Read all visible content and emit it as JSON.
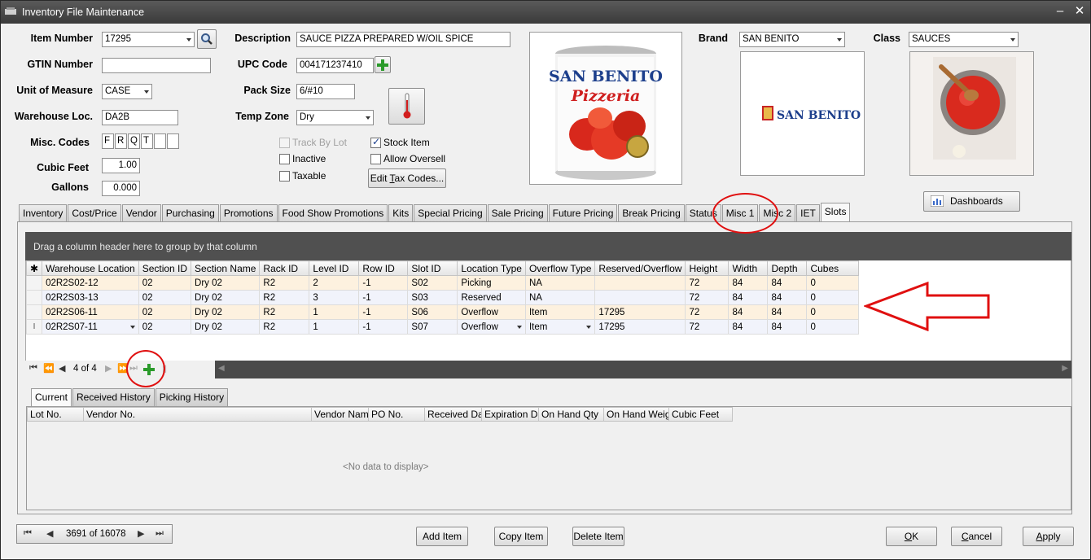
{
  "window": {
    "title": "Inventory File Maintenance",
    "min_glyph": "‒",
    "close_glyph": "✕"
  },
  "form": {
    "item_number_label": "Item Number",
    "item_number": "17295",
    "gtin_label": "GTIN Number",
    "gtin": "",
    "uom_label": "Unit of Measure",
    "uom": "CASE",
    "warehouse_label": "Warehouse Loc.",
    "warehouse": "DA2B",
    "misc_label": "Misc. Codes",
    "misc_codes": [
      "F",
      "R",
      "Q",
      "T",
      "",
      ""
    ],
    "cubic_label": "Cubic Feet",
    "cubic": "1.00",
    "gallons_label": "Gallons",
    "gallons": "0.000",
    "description_label": "Description",
    "description": "SAUCE PIZZA PREPARED W/OIL SPICE",
    "upc_label": "UPC Code",
    "upc": "004171237410",
    "pack_label": "Pack Size",
    "pack": "6/#10",
    "temp_label": "Temp Zone",
    "temp": "Dry",
    "brand_label": "Brand",
    "brand": "SAN BENITO",
    "class_label": "Class",
    "class": "SAUCES",
    "product_brand_text": "SAN BENITO",
    "product_sub_text": "Pizzeria",
    "brand_logo_text": "SAN BENITO"
  },
  "checkboxes": {
    "track_by_lot": {
      "label": "Track By Lot",
      "checked": false,
      "disabled": true
    },
    "inactive": {
      "label": "Inactive",
      "checked": false
    },
    "taxable": {
      "label": "Taxable",
      "checked": false
    },
    "stock_item": {
      "label": "Stock Item",
      "checked": true
    },
    "allow_oversell": {
      "label": "Allow Oversell",
      "checked": false
    }
  },
  "buttons": {
    "edit_tax_pre": "Edit ",
    "edit_tax_acc": "T",
    "edit_tax_post": "ax Codes...",
    "dashboards": "Dashboards",
    "add_item": "Add Item",
    "copy_item": "Copy Item",
    "delete_item": "Delete Item",
    "ok_acc": "O",
    "ok_post": "K",
    "cancel_acc": "C",
    "cancel_post": "ancel",
    "apply_acc": "A",
    "apply_post": "pply"
  },
  "tabs": [
    "Inventory",
    "Cost/Price",
    "Vendor",
    "Purchasing",
    "Promotions",
    "Food Show Promotions",
    "Kits",
    "Special Pricing",
    "Sale Pricing",
    "Future Pricing",
    "Break Pricing",
    "Status",
    "Misc 1",
    "Misc 2",
    "IET",
    "Slots"
  ],
  "active_tab": "Slots",
  "slots": {
    "group_hint": "Drag a column header here to group by that column",
    "new_row_glyph": "✱",
    "columns": [
      "Warehouse Location",
      "Section ID",
      "Section Name",
      "Rack ID",
      "Level ID",
      "Row ID",
      "Slot ID",
      "Location Type",
      "Overflow Type",
      "Reserved/Overflow",
      "Height",
      "Width",
      "Depth",
      "Cubes"
    ],
    "rows": [
      [
        "02R2S02-12",
        "02",
        "Dry 02",
        "R2",
        "2",
        "-1",
        "S02",
        "Picking",
        "NA",
        "",
        "72",
        "84",
        "84",
        "0"
      ],
      [
        "02R2S03-13",
        "02",
        "Dry 02",
        "R2",
        "3",
        "-1",
        "S03",
        "Reserved",
        "NA",
        "",
        "72",
        "84",
        "84",
        "0"
      ],
      [
        "02R2S06-11",
        "02",
        "Dry 02",
        "R2",
        "1",
        "-1",
        "S06",
        "Overflow",
        "Item",
        "17295",
        "72",
        "84",
        "84",
        "0"
      ],
      [
        "02R2S07-11",
        "02",
        "Dry 02",
        "R2",
        "1",
        "-1",
        "S07",
        "Overflow",
        "Item",
        "17295",
        "72",
        "84",
        "84",
        "0"
      ]
    ],
    "current_row_marker": "I",
    "pager": "4 of 4"
  },
  "lot_tabs": [
    "Current",
    "Received History",
    "Picking History"
  ],
  "lot_columns": [
    "Lot No.",
    "Vendor No.",
    "Vendor Name",
    "PO No.",
    "Received Dat",
    "Expiration Dat",
    "On Hand Qty",
    "On Hand Weigh",
    "Cubic Feet"
  ],
  "lot_empty": "<No data to display>",
  "record_nav": "3691 of 16078",
  "colors": {
    "annotation_red": "#e01010",
    "grid_header_dark": "#505050"
  }
}
